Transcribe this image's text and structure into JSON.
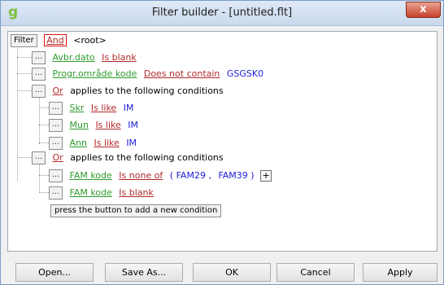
{
  "window": {
    "title": "Filter builder - [untitled.flt]",
    "app_icon_glyph": "g",
    "close_glyph": "x"
  },
  "tree": {
    "filter_label": "Filter",
    "root_operator": "And",
    "root_label": "<root>",
    "ellipsis": "...",
    "conditions": [
      {
        "field": "Avbr.dato",
        "operator": "Is blank",
        "value": ""
      },
      {
        "field": "Progr.område kode",
        "operator": "Does not contain",
        "value": "GSGSK0"
      }
    ],
    "group1": {
      "operator": "Or",
      "text": "applies to the following conditions",
      "conditions": [
        {
          "field": "Skr",
          "operator": "Is like",
          "value": "IM"
        },
        {
          "field": "Mun",
          "operator": "Is like",
          "value": "IM"
        },
        {
          "field": "Ann",
          "operator": "Is like",
          "value": "IM"
        }
      ]
    },
    "group2": {
      "operator": "Or",
      "text": "applies to the following conditions",
      "conditions": [
        {
          "field": "FAM kode",
          "operator": "Is none of",
          "open_paren": "(",
          "value1": "FAM29",
          "comma": ",",
          "value2": "FAM39",
          "close_paren": ")",
          "plus": "+"
        },
        {
          "field": "FAM kode",
          "operator": "Is blank"
        }
      ]
    },
    "add_hint": "press the button to add a new condition"
  },
  "buttons": {
    "open": "Open...",
    "save_as": "Save As...",
    "ok": "OK",
    "cancel": "Cancel",
    "apply": "Apply"
  }
}
